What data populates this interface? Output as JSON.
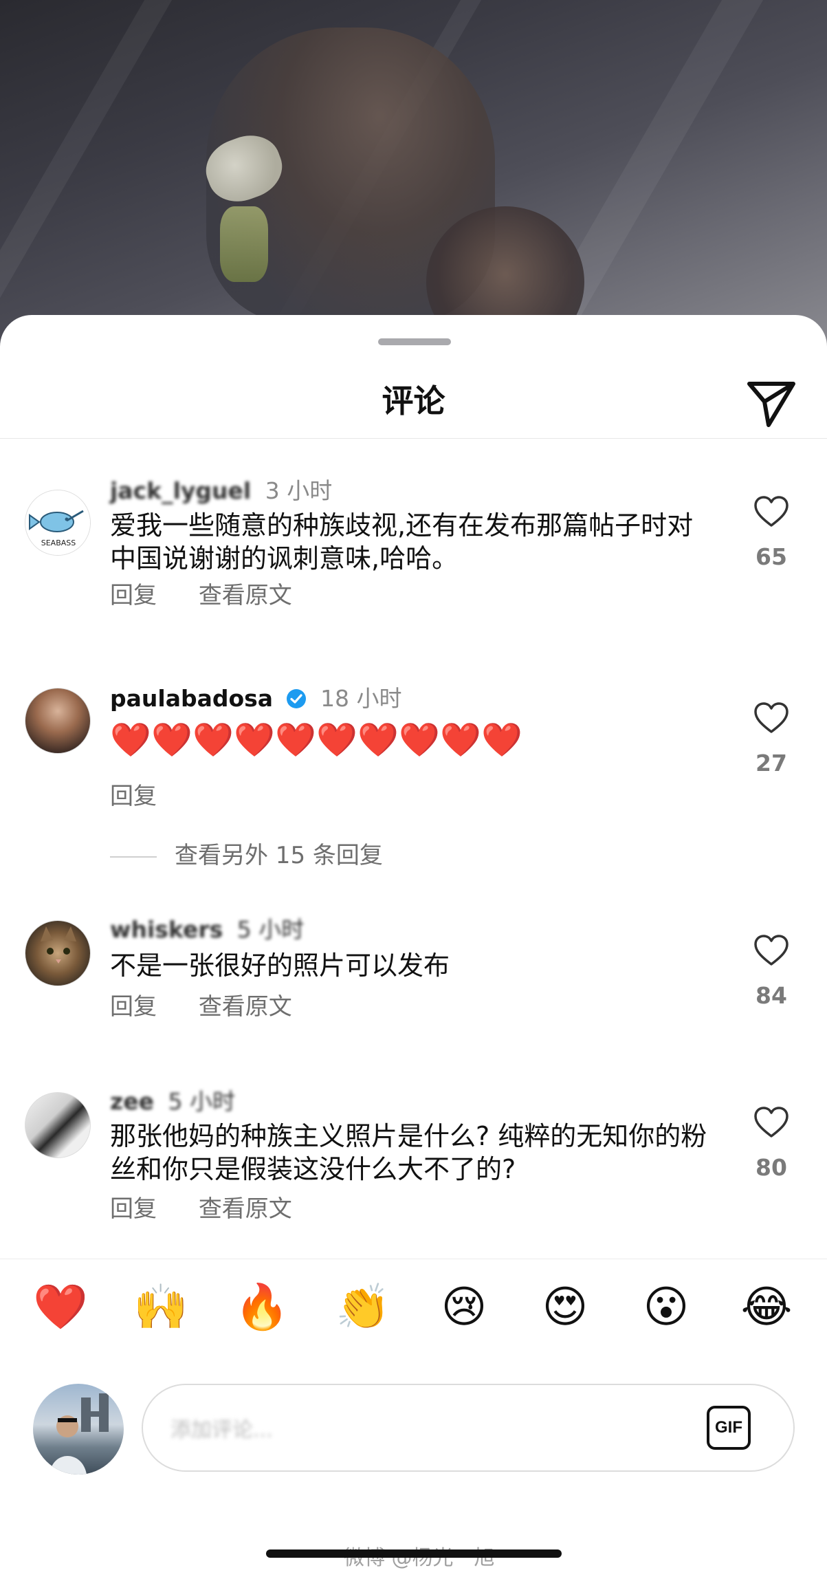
{
  "sheet": {
    "title": "评论"
  },
  "comments": [
    {
      "username": "jack_lyguel",
      "time": "3 小时",
      "text": "爱我一些随意的种族歧视,还有在发布那篇帖子时对中国说谢谢的讽刺意味,哈哈。",
      "reply": "回复",
      "translate": "查看原文",
      "likes": "65",
      "avatar_icon": "seabass-logo-avatar",
      "avatar_text": "SEABASS"
    },
    {
      "username": "paulabadosa",
      "time": "18 小时",
      "verified": true,
      "hearts": [
        "❤️",
        "❤️",
        "❤️",
        "❤️",
        "❤️",
        "❤️",
        "❤️",
        "❤️",
        "❤️",
        "❤️"
      ],
      "reply": "回复",
      "likes": "27",
      "more_replies": "查看另外 15 条回复"
    },
    {
      "username": "whiskers",
      "time": "5 小时",
      "text": "不是一张很好的照片可以发布",
      "reply": "回复",
      "translate": "查看原文",
      "likes": "84",
      "avatar_icon": "cat-avatar"
    },
    {
      "username": "zee",
      "time": "5 小时",
      "text": "那张他妈的种族主义照片是什么? 纯粹的无知你的粉丝和你只是假装这没什么大不了的?",
      "reply": "回复",
      "translate": "查看原文",
      "likes": "80"
    }
  ],
  "emoji_bar": [
    "❤️",
    "🙌",
    "🔥",
    "👏",
    "😢",
    "😍",
    "😮",
    "😂"
  ],
  "composer": {
    "placeholder": "添加评论...",
    "gif_label": "GIF"
  },
  "watermark": "微博 @杨光一旭",
  "colors": {
    "heart_red": "#e0141e",
    "verified_blue": "#1d9bf0",
    "muted_text": "#6e6e6e"
  }
}
